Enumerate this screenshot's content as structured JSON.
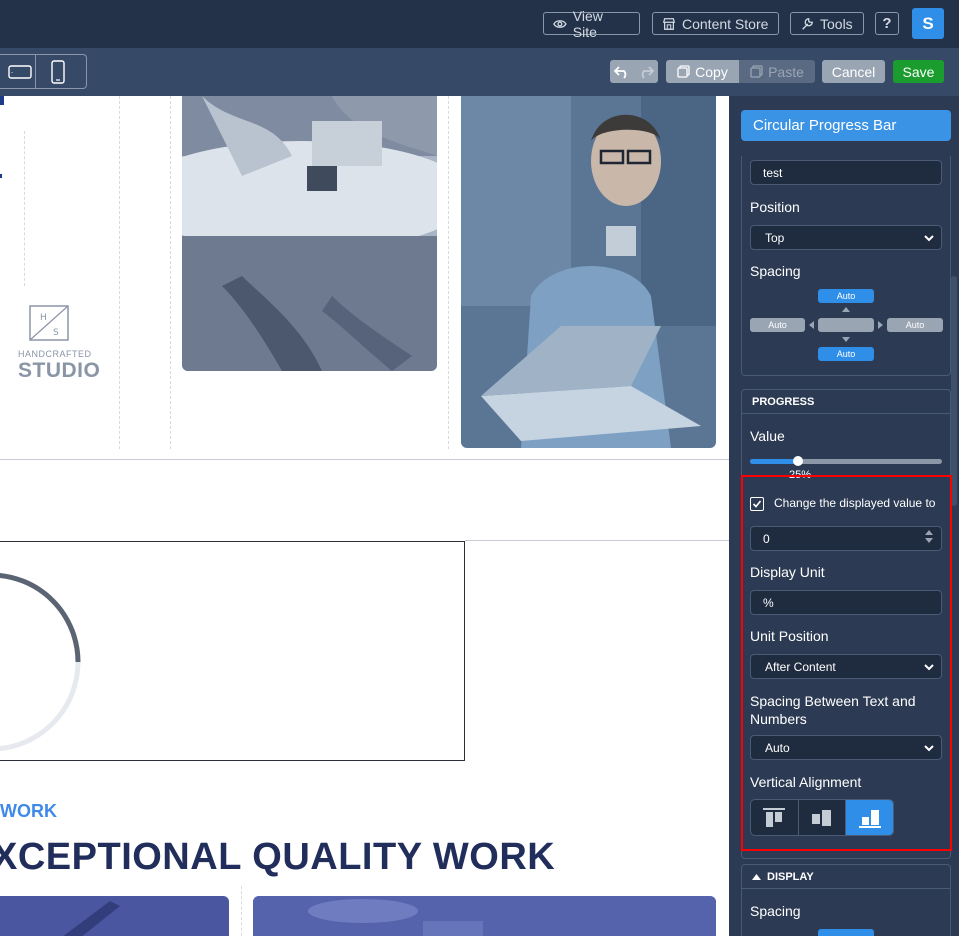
{
  "topbar": {
    "view_site": "View Site",
    "content_store": "Content Store",
    "tools": "Tools",
    "help": "?",
    "avatar_letter": "S"
  },
  "toolbar": {
    "copy": "Copy",
    "paste": "Paste",
    "cancel": "Cancel",
    "save": "Save"
  },
  "canvas": {
    "logo_top": "H S",
    "logo_small": "HANDCRAFTED",
    "logo_big": "STUDIO",
    "work_label": "WORK",
    "headline": "XCEPTIONAL QUALITY WORK"
  },
  "panel": {
    "title": "Circular Progress Bar",
    "text_value": "test",
    "position_label": "Position",
    "position_value": "Top",
    "spacing_label": "Spacing",
    "spacing": {
      "top": "Auto",
      "left": "Auto",
      "right": "Auto",
      "bottom": "Auto"
    },
    "progress_header": "PROGRESS",
    "value_label": "Value",
    "value_display": "25%",
    "value_fraction": 0.25,
    "change_label": "Change the displayed value to",
    "change_value": "0",
    "display_unit_label": "Display Unit",
    "display_unit_value": "%",
    "unit_position_label": "Unit Position",
    "unit_position_value": "After Content",
    "spacing_between_label": "Spacing Between Text and Numbers",
    "spacing_between_value": "Auto",
    "vertical_alignment_label": "Vertical Alignment",
    "display_header": "DISPLAY",
    "display_spacing_label": "Spacing"
  },
  "colors": {
    "topbar": "#233249",
    "subbar": "#364a68",
    "panel": "#2c3b53",
    "accent": "#2f8ee8",
    "save": "#1a9d2e",
    "headline": "#212d5b",
    "highlight": "#ff0000"
  }
}
